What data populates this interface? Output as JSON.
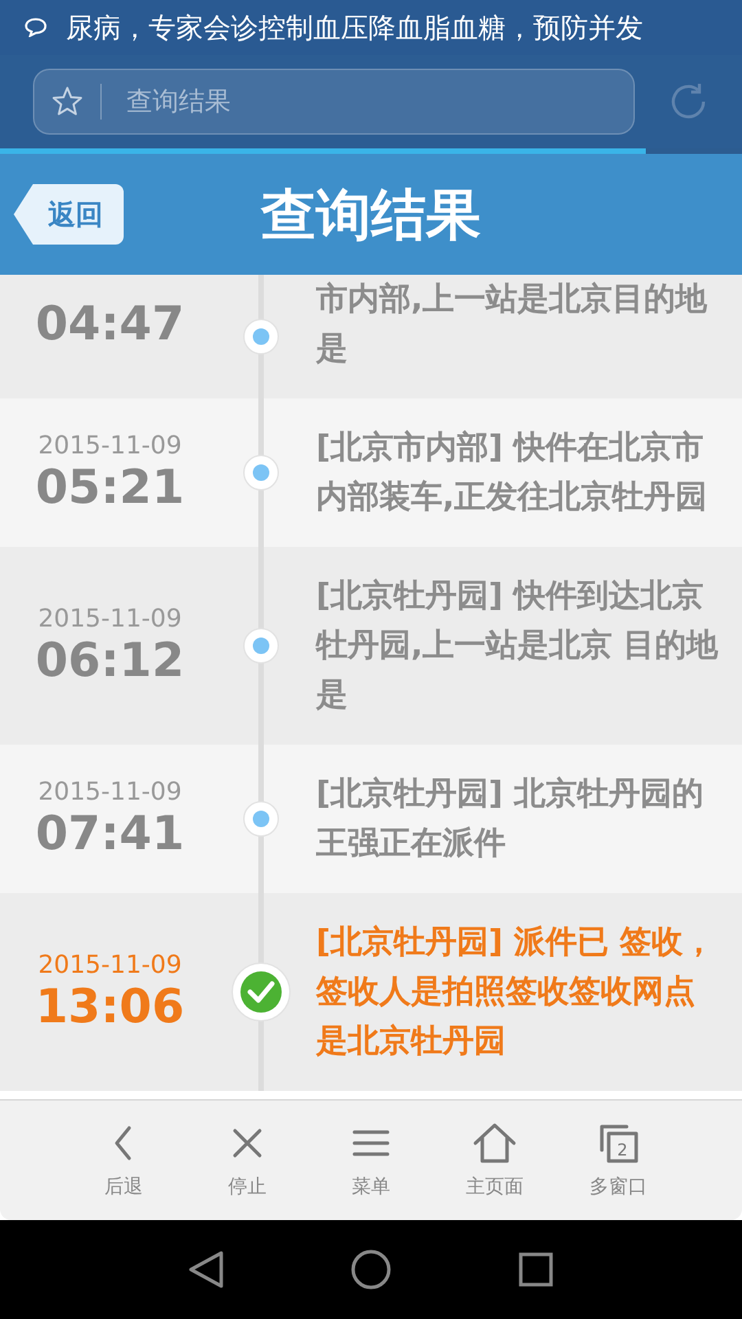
{
  "status_bar": {
    "notification": "尿病，专家会诊控制血压降血脂血糖，预防并发"
  },
  "address_bar": {
    "value": "查询结果"
  },
  "page_load": {
    "level": 0.87
  },
  "header": {
    "back": "返回",
    "title": "查询结果"
  },
  "events": [
    {
      "time": "04:47",
      "text": "市内部,上一站是北京目的地是",
      "signed": false
    },
    {
      "date": "2015-11-09",
      "time": "05:21",
      "text": "[北京市内部] 快件在北京市内部装车,正发往北京牡丹园",
      "signed": false
    },
    {
      "date": "2015-11-09",
      "time": "06:12",
      "text": "[北京牡丹园] 快件到达北京牡丹园,上一站是北京 目的地是",
      "signed": false
    },
    {
      "date": "2015-11-09",
      "time": "07:41",
      "text": "[北京牡丹园] 北京牡丹园的王强正在派件",
      "signed": false
    },
    {
      "date": "2015-11-09",
      "time": "13:06",
      "text": "[北京牡丹园] 派件已 签收，签收人是拍照签收签收网点是北京牡丹园",
      "signed": true
    }
  ],
  "toolbar": [
    {
      "kind": "back",
      "label": "后退"
    },
    {
      "kind": "stop",
      "label": "停止"
    },
    {
      "kind": "menu",
      "label": "菜单"
    },
    {
      "kind": "home",
      "label": "主页面"
    },
    {
      "kind": "windows",
      "label": "多窗口",
      "count": "2"
    }
  ]
}
